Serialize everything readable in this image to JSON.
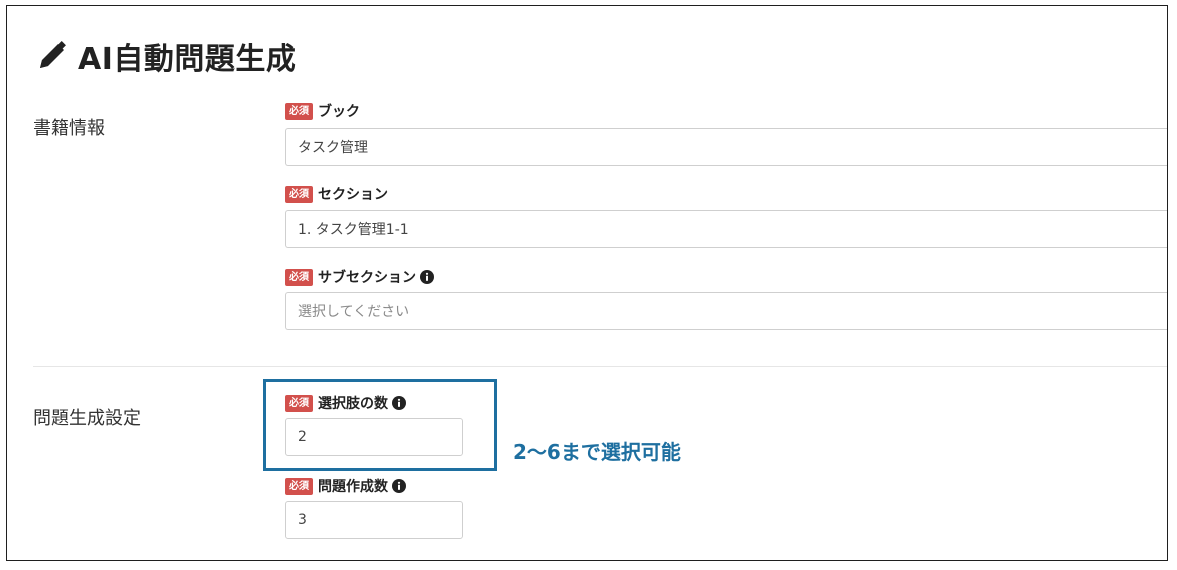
{
  "page": {
    "title": "AI自動問題生成"
  },
  "sections": {
    "book_info": {
      "label": "書籍情報"
    },
    "generation_settings": {
      "label": "問題生成設定"
    }
  },
  "badge": {
    "required": "必須"
  },
  "fields": {
    "book": {
      "label": "ブック",
      "value": "タスク管理"
    },
    "section": {
      "label": "セクション",
      "value": "1. タスク管理1-1"
    },
    "subsection": {
      "label": "サブセクション",
      "placeholder": "選択してください",
      "icon": "info-circle-icon"
    },
    "choices_count": {
      "label": "選択肢の数",
      "value": "2",
      "icon": "info-circle-icon"
    },
    "question_count": {
      "label": "問題作成数",
      "value": "3",
      "icon": "info-circle-icon"
    }
  },
  "annotation": {
    "text": "2〜6まで選択可能",
    "color": "#1e6fa0"
  },
  "colors": {
    "required_badge": "#d2504c",
    "highlight": "#1e6fa0"
  }
}
